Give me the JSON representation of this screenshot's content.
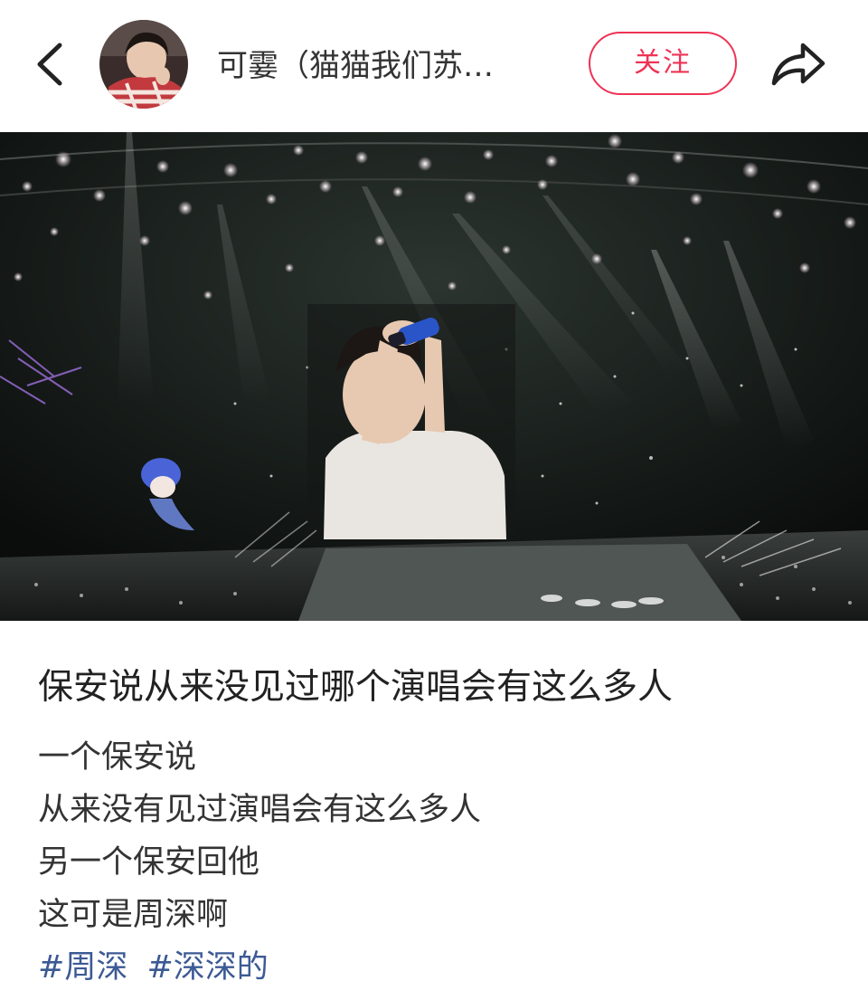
{
  "header": {
    "back_icon": "chevron-left-icon",
    "author_name": "可霎（猫猫我们苏…",
    "follow_label": "关注",
    "share_icon": "share-arrow-icon",
    "accent_color": "#ee3355"
  },
  "post": {
    "title": "保安说从来没见过哪个演唱会有这么多人",
    "lines": [
      "一个保安说",
      "从来没有见过演唱会有这么多人",
      "另一个保安回他",
      "这可是周深啊"
    ],
    "tags": [
      "#周深",
      "#深深的"
    ],
    "tag_color": "#3c5a94"
  }
}
